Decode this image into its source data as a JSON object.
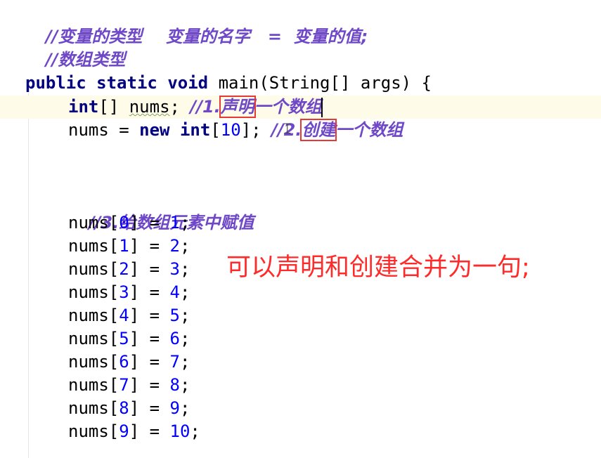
{
  "comments_top": {
    "line1": "//变量的类型    变量的名字   =  变量的值;",
    "line2": "//数组类型"
  },
  "main_decl": {
    "kw_public": "public",
    "kw_static": "static",
    "kw_void": "void",
    "rest": "main(String[] args) {"
  },
  "declare_line": {
    "type_kw": "int",
    "type_rest": "[] ",
    "var": "nums",
    "semi": "; ",
    "comment_prefix": "//1.",
    "comment_boxed": "声明",
    "comment_suffix": "一个数组"
  },
  "create_line": {
    "prefix": "nums = ",
    "kw_new": "new",
    "kw_int": "int",
    "bracket_open": "[",
    "size": "10",
    "bracket_close": "]; ",
    "comment_prefix": "//2.",
    "comment_boxed": "创建",
    "comment_suffix": "一个数组"
  },
  "assign_comment": "//3.给数组元素中赋值",
  "assignments": [
    {
      "index": "0",
      "value": "1"
    },
    {
      "index": "1",
      "value": "2"
    },
    {
      "index": "2",
      "value": "3"
    },
    {
      "index": "3",
      "value": "4"
    },
    {
      "index": "4",
      "value": "5"
    },
    {
      "index": "5",
      "value": "6"
    },
    {
      "index": "6",
      "value": "7"
    },
    {
      "index": "7",
      "value": "8"
    },
    {
      "index": "8",
      "value": "9"
    },
    {
      "index": "9",
      "value": "10"
    }
  ],
  "note": "可以声明和创建合并为一句;",
  "colors": {
    "keyword": "#000080",
    "comment": "#6f48c7",
    "number": "#0000ff",
    "highlight_box": "#e53935",
    "note": "#ff2a2a",
    "caret_line": "#fffbe9"
  }
}
